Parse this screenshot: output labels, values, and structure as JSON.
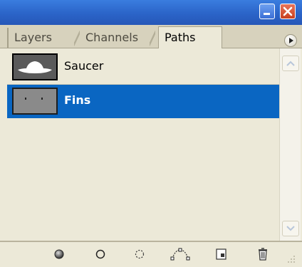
{
  "panel": {
    "tabs": [
      {
        "label": "Layers",
        "active": false
      },
      {
        "label": "Channels",
        "active": false
      },
      {
        "label": "Paths",
        "active": true
      }
    ],
    "menu_icon": "triangle-right-icon"
  },
  "paths": [
    {
      "name": "Saucer",
      "selected": false,
      "thumbnail": "saucer-shape"
    },
    {
      "name": "Fins",
      "selected": true,
      "thumbnail": "fins-dots"
    }
  ],
  "toolbar": {
    "items": [
      {
        "icon": "fill-path-icon"
      },
      {
        "icon": "stroke-path-icon"
      },
      {
        "icon": "load-path-as-selection-icon"
      },
      {
        "icon": "make-work-path-icon"
      },
      {
        "icon": "new-path-icon"
      },
      {
        "icon": "delete-path-icon"
      }
    ]
  },
  "colors": {
    "selection": "#0a66c2",
    "panel_bg": "#ece9d8",
    "titlebar": "#2b64c8"
  }
}
